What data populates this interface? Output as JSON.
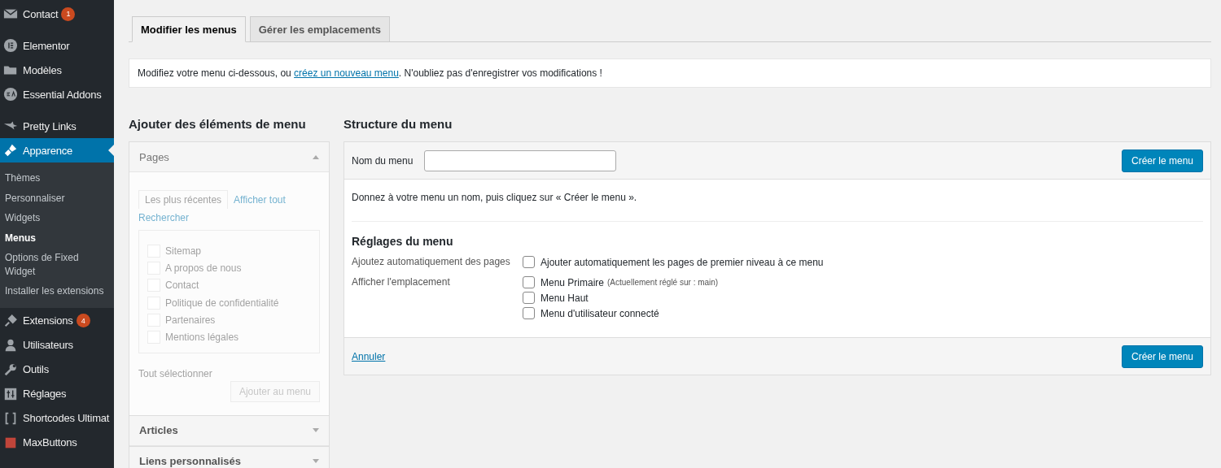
{
  "sidebar": {
    "items": [
      {
        "label": "Contact",
        "badge": "1",
        "selected": false
      },
      {
        "label": "Elementor",
        "selected": false
      },
      {
        "label": "Modèles",
        "selected": false
      },
      {
        "label": "Essential Addons",
        "selected": false
      },
      {
        "label": "Pretty Links",
        "selected": false
      },
      {
        "label": "Apparence",
        "selected": true,
        "children": [
          {
            "label": "Thèmes",
            "selected": false
          },
          {
            "label": "Personnaliser",
            "selected": false
          },
          {
            "label": "Widgets",
            "selected": false
          },
          {
            "label": "Menus",
            "selected": true
          },
          {
            "label": "Options de Fixed Widget",
            "selected": false
          },
          {
            "label": "Installer les extensions",
            "selected": false
          }
        ]
      },
      {
        "label": "Extensions",
        "badge": "4",
        "selected": false
      },
      {
        "label": "Utilisateurs",
        "selected": false
      },
      {
        "label": "Outils",
        "selected": false
      },
      {
        "label": "Réglages",
        "selected": false
      },
      {
        "label": "Shortcodes Ultimat",
        "selected": false
      },
      {
        "label": "MaxButtons",
        "selected": false
      }
    ]
  },
  "tabs": [
    {
      "label": "Modifier les menus",
      "selected": true
    },
    {
      "label": "Gérer les emplacements",
      "selected": false
    }
  ],
  "notice": {
    "before": "Modifiez votre menu ci-dessous, ou ",
    "link": "créez un nouveau menu",
    "after": ". N'oubliez pas d'enregistrer vos modifications !"
  },
  "add_items": {
    "heading": "Ajouter des éléments de menu",
    "sections": [
      {
        "title": "Pages",
        "expanded": true,
        "disabled": true,
        "tabs": [
          {
            "label": "Les plus récentes",
            "selected": true
          },
          {
            "label": "Afficher tout",
            "selected": false
          },
          {
            "label": "Rechercher",
            "selected": false
          }
        ],
        "items": [
          {
            "label": "Sitemap",
            "checked": false
          },
          {
            "label": "A propos de nous",
            "checked": false
          },
          {
            "label": "Contact",
            "checked": false
          },
          {
            "label": "Politique de confidentialité",
            "checked": false
          },
          {
            "label": "Partenaires",
            "checked": false
          },
          {
            "label": "Mentions légales",
            "checked": false
          }
        ],
        "select_all": "Tout sélectionner",
        "button": "Ajouter au menu"
      },
      {
        "title": "Articles",
        "expanded": false
      },
      {
        "title": "Liens personnalisés",
        "expanded": false
      }
    ]
  },
  "structure": {
    "heading": "Structure du menu",
    "name_label": "Nom du menu",
    "create_button": "Créer le menu",
    "instructions": "Donnez à votre menu un nom, puis cliquez sur « Créer le menu ».",
    "settings_heading": "Réglages du menu",
    "settings": [
      {
        "label": "Ajoutez automatiquement des pages",
        "options": [
          {
            "label": "Ajouter automatiquement les pages de premier niveau à ce menu",
            "checked": false
          }
        ]
      },
      {
        "label": "Afficher l'emplacement",
        "options": [
          {
            "label": "Menu Primaire",
            "note": "(Actuellement réglé sur : main)",
            "checked": false
          },
          {
            "label": "Menu Haut",
            "checked": false
          },
          {
            "label": "Menu d'utilisateur connecté",
            "checked": false
          }
        ]
      }
    ],
    "cancel": "Annuler",
    "footer_button": "Créer le menu"
  }
}
